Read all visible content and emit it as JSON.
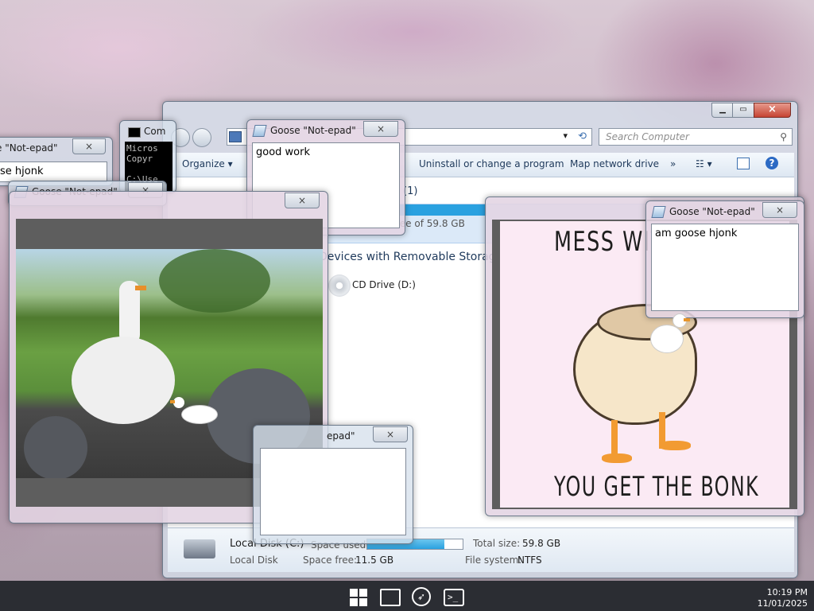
{
  "explorer": {
    "search_placeholder": "Search Computer",
    "toolbar": {
      "organize": "Organize",
      "uninstall": "Uninstall or change a program",
      "map_drive": "Map network drive",
      "more": "»"
    },
    "hard_disks_count": "(1)",
    "disk_free_text": "11.5 GB free of 59.8 GB",
    "removable_header": "Devices with Removable Storage",
    "cd_drive": "CD Drive (D:)",
    "details": {
      "name": "Local Disk (C:)",
      "space_used_label": "Space used:",
      "type": "Local Disk",
      "space_free_label": "Space free:",
      "space_free": "11.5 GB",
      "total_size_label": "Total size:",
      "total_size": "59.8 GB",
      "filesystem_label": "File system:",
      "filesystem": "NTFS",
      "used_fraction": 0.81
    }
  },
  "cmd": {
    "title": "Com",
    "lines": [
      "Micros",
      "Copyr",
      "",
      "C:\\Use"
    ]
  },
  "notepads": [
    {
      "title": "Goose \"Not-epad\"",
      "text": "good work"
    },
    {
      "title": "Goose \"Not-epad\"",
      "text": "am goose hjonk"
    },
    {
      "title": "e \"Not-epad\"",
      "text": "se hjonk"
    },
    {
      "title": "Goose \"Not-epad\"",
      "text": ""
    },
    {
      "title": "epad\"",
      "text": ""
    }
  ],
  "meme": {
    "top_text": "MESS WITH",
    "bottom_text": "YOU GET THE BONK"
  },
  "taskbar": {
    "time": "10:19 PM",
    "date": "11/01/2025"
  },
  "icons": {
    "close": "×",
    "dropdown": "▾",
    "windows_logo": "windows-icon",
    "folder": "folder-icon",
    "browser": "compass-icon",
    "terminal": "terminal-icon"
  }
}
